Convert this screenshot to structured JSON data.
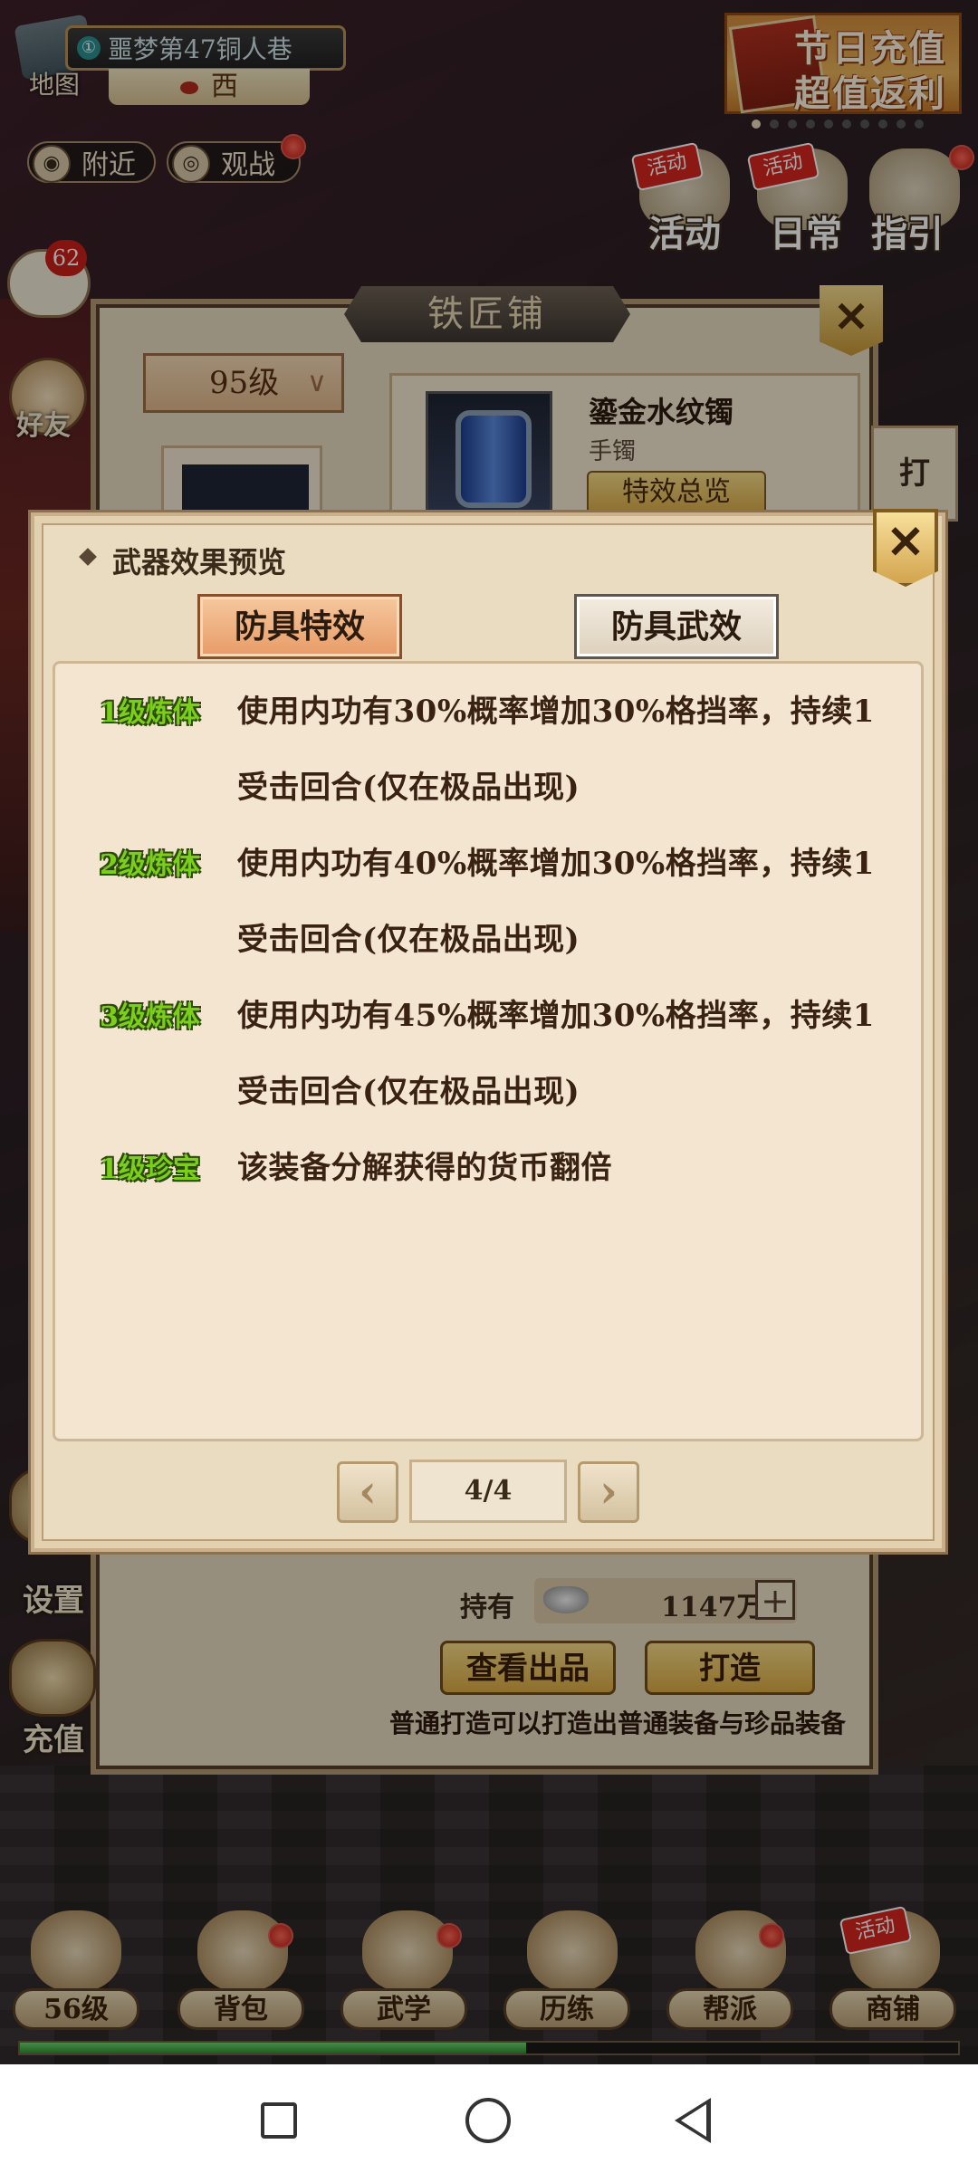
{
  "hud": {
    "location": "噩梦第47铜人巷",
    "location_badge": "①",
    "map_label": "地图",
    "direction": "西",
    "nearby": "附近",
    "spectate": "观战",
    "banner_line1": "节日充值",
    "banner_line2": "超值返利",
    "activity": "活动",
    "daily": "日常",
    "guide": "指引",
    "activity_tag": "活动",
    "chat_count": "62",
    "friends": "好友"
  },
  "smith": {
    "title": "铁匠铺",
    "level_select": "95级",
    "item_name": "鎏金水纹镯",
    "item_type": "手镯",
    "effect_overview": "特效总览",
    "side_tab": "打",
    "hold_label": "持有",
    "hold_value": "1147万",
    "view_output": "查看出品",
    "forge": "打造",
    "hint": "普通打造可以打造出普通装备与珍品装备"
  },
  "side_menu": {
    "settings": "设置",
    "recharge": "充值"
  },
  "modal": {
    "title": "武器效果预览",
    "tab_active": "防具特效",
    "tab_inactive": "防具武效",
    "effects": [
      {
        "level": "1级炼体",
        "line1": "使用内功有30%概率增加30%格挡率，持续1",
        "line2": "受击回合(仅在极品出现)"
      },
      {
        "level": "2级炼体",
        "line1": "使用内功有40%概率增加30%格挡率，持续1",
        "line2": "受击回合(仅在极品出现)"
      },
      {
        "level": "3级炼体",
        "line1": "使用内功有45%概率增加30%格挡率，持续1",
        "line2": "受击回合(仅在极品出现)"
      },
      {
        "level": "1级珍宝",
        "line1": "该装备分解获得的货币翻倍",
        "line2": ""
      }
    ],
    "page": "4/4",
    "prev_icon": "chevron-left-icon",
    "next_icon": "chevron-right-icon"
  },
  "bottom_nav": {
    "items": [
      "56级",
      "背包",
      "武学",
      "历练",
      "帮派",
      "商铺"
    ],
    "xp_fraction": 0.54
  },
  "colors": {
    "effect_level": "#7bcf1b",
    "tab_active": "#e79b66",
    "close_gold": "#d1a14a"
  }
}
